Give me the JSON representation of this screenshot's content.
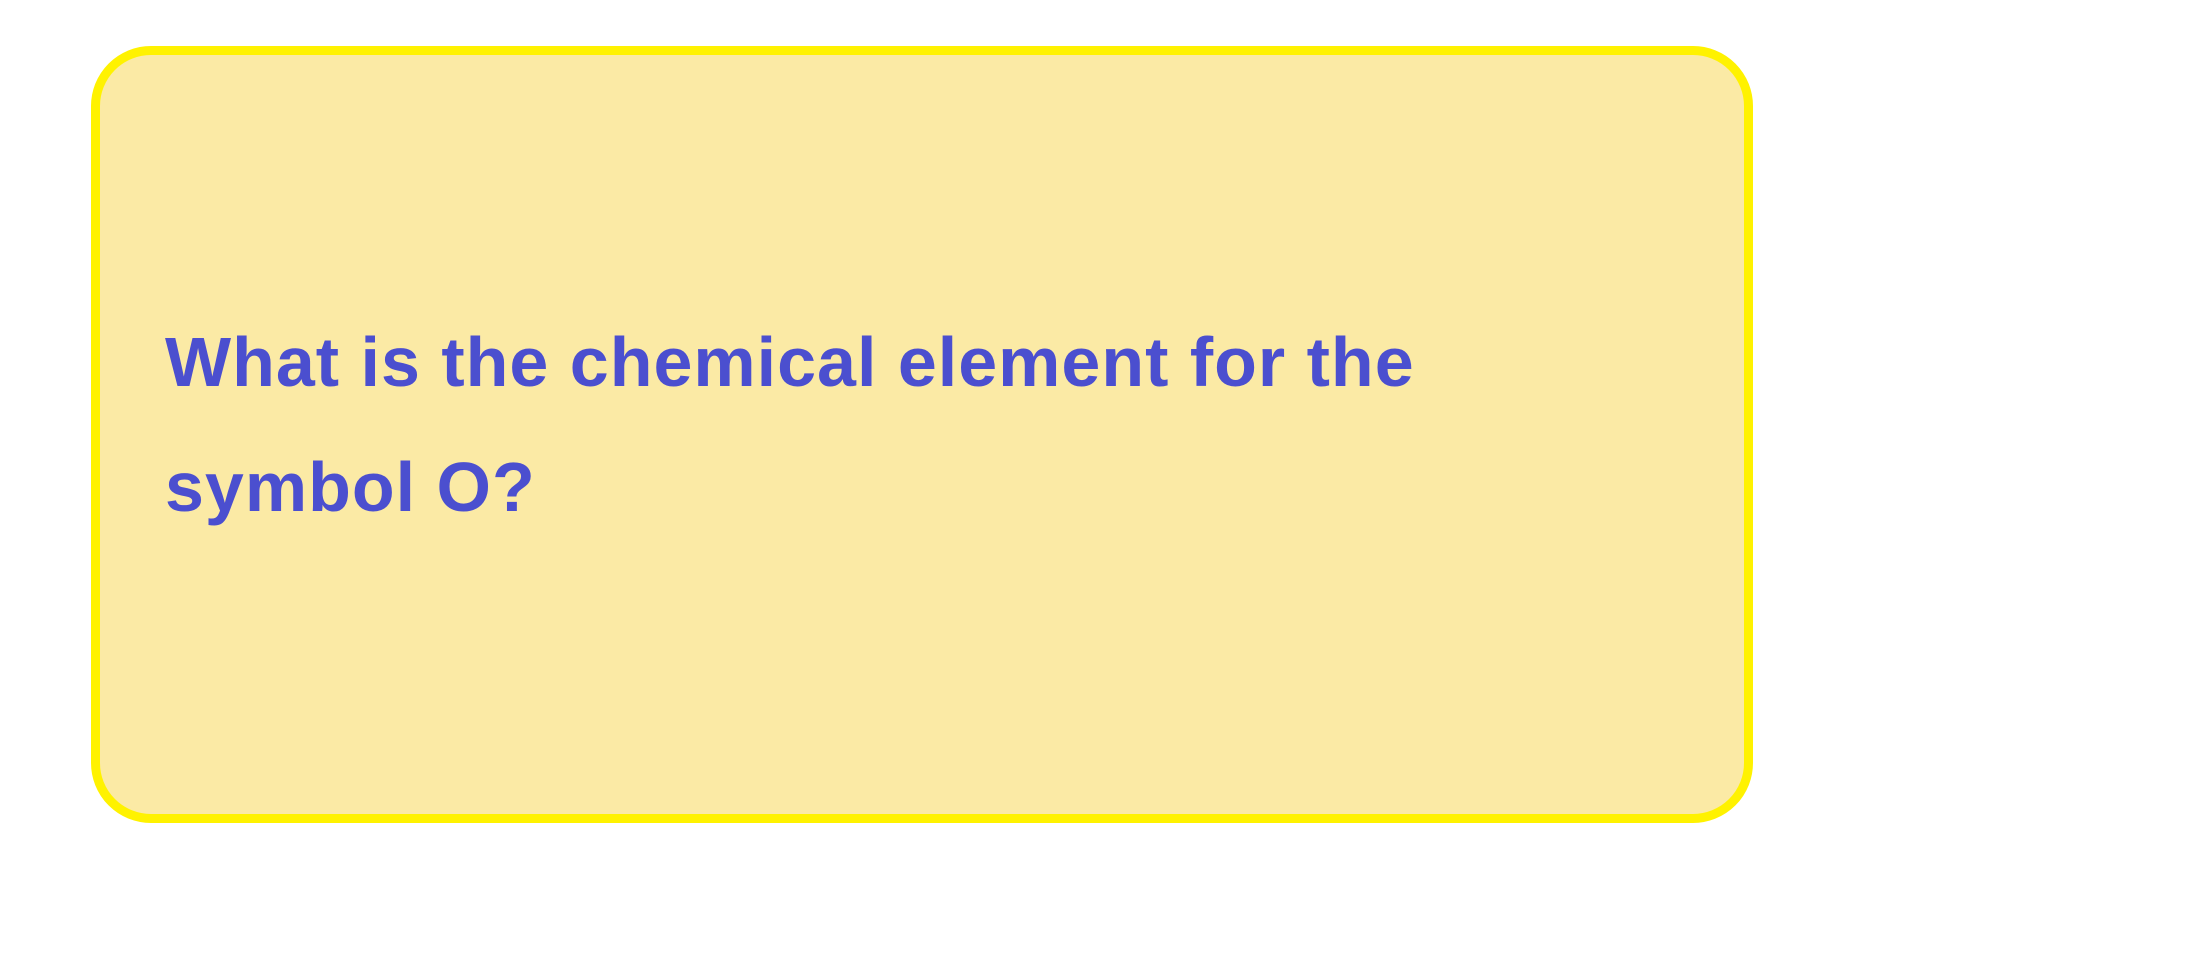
{
  "question": {
    "text": "What is the chemical element for the symbol O?"
  },
  "colors": {
    "card_fill": "#fbeaa5",
    "card_border": "#fff200",
    "text": "#4b4fcf"
  }
}
